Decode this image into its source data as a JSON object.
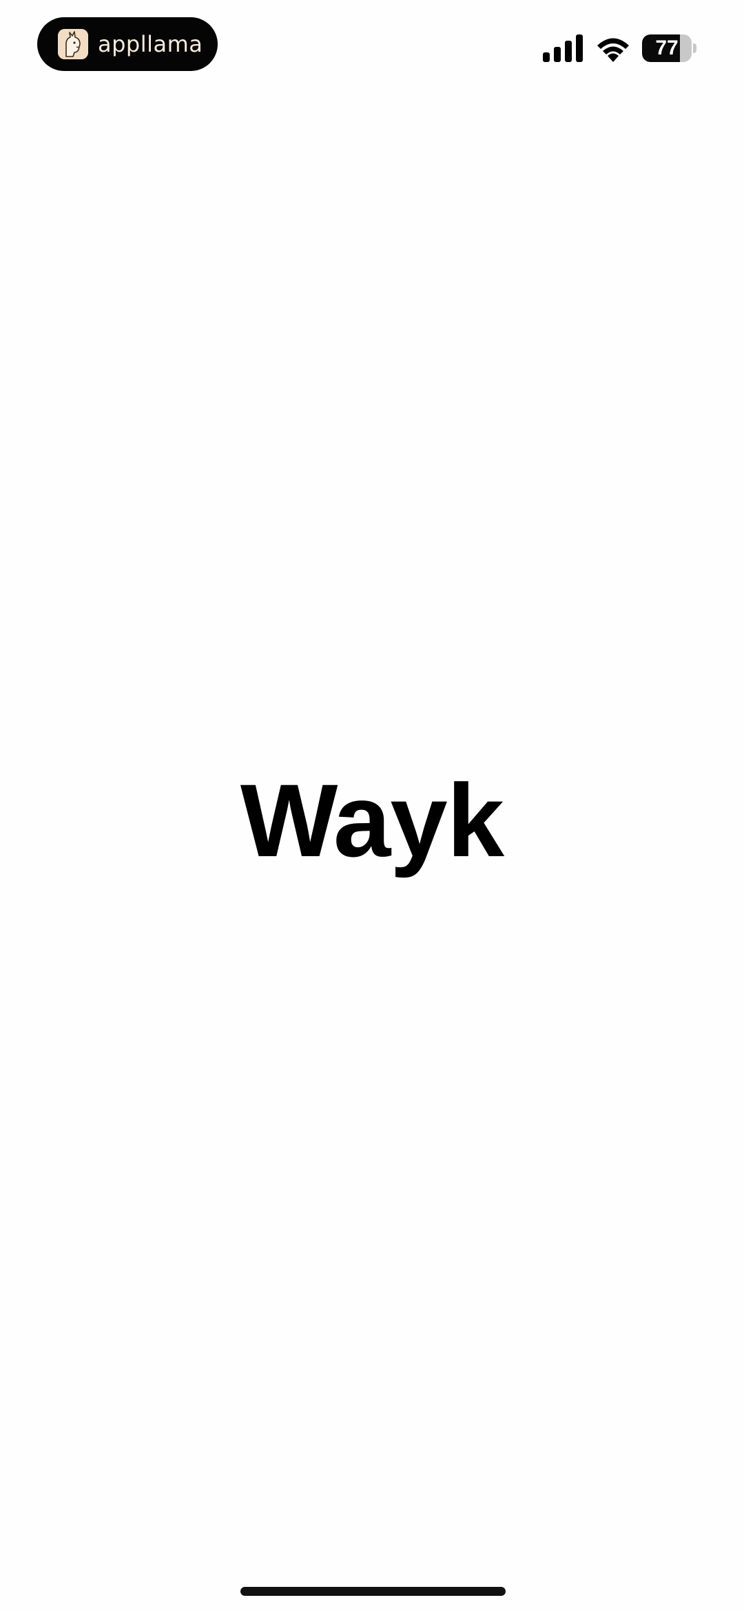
{
  "status_bar": {
    "app_badge": {
      "label": "appllama",
      "icon": "llama-icon",
      "background": "#050505",
      "text_color": "#F6EBDD"
    },
    "signal": {
      "icon": "cellular-signal-icon",
      "bars": 4
    },
    "wifi": {
      "icon": "wifi-icon"
    },
    "battery": {
      "icon": "battery-icon",
      "level": 77,
      "level_text": "77"
    }
  },
  "splash": {
    "title": "Wayk"
  },
  "colors": {
    "background": "#FEFEFE",
    "text": "#000000"
  }
}
